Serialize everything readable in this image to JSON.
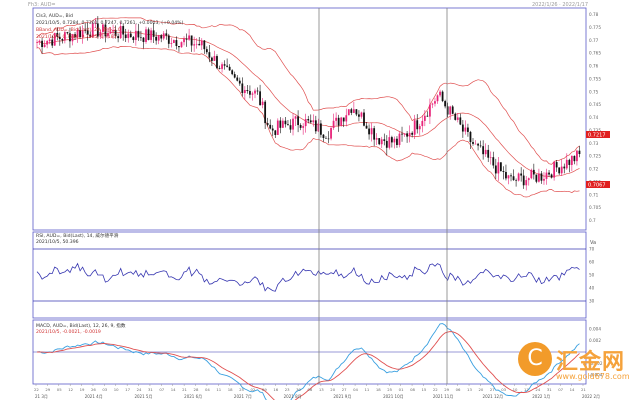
{
  "header": {
    "left": "Fh3: AUD=",
    "right": "2022/1/26 · 2022/1/17"
  },
  "main_panel": {
    "title": "Cls3, AUD=, Bid",
    "ohlc_line": "2021/10/5, 0.7284, 0.7301, 0.7247, 0.7261, +0.0003, (+0.04%)",
    "bb_title": "BBand, AUD=, Bid(Last), 20, 最多,2.0",
    "bb_values": "2021/10/5, 0.7386, 0.7285, 0.7183",
    "price_tag": "0.7217",
    "lower_tag": "0.7067",
    "y_ticks": [
      "0.78",
      "0.775",
      "0.77",
      "0.765",
      "0.76",
      "0.755",
      "0.75",
      "0.745",
      "0.74",
      "0.735",
      "0.73",
      "0.725",
      "0.72",
      "0.715",
      "0.71",
      "0.705",
      "0.7"
    ]
  },
  "rsi_panel": {
    "title": "RSI, AUD=, Bid(Last), 14, 威尔德平滑",
    "value_line": "2021/10/5, 50.396",
    "unit": "Va",
    "y_ticks": [
      "70",
      "60",
      "50",
      "40",
      "30"
    ]
  },
  "macd_panel": {
    "title": "MACD, AUD=, Bid(Last), 12, 26, 9, 指数",
    "value_line": "2021/10/5, -0.0021, -0.0019",
    "y_ticks": [
      "0.004",
      "0.002",
      "0",
      "-0.002",
      "-0.004"
    ]
  },
  "x_axis": {
    "ticks_top": [
      "22",
      "29",
      "05",
      "12",
      "19",
      "26",
      "03",
      "10",
      "17",
      "24",
      "31",
      "07",
      "14",
      "21",
      "28",
      "04",
      "11",
      "18",
      "25",
      "02",
      "09",
      "16",
      "23",
      "30",
      "06",
      "13",
      "20",
      "27",
      "04",
      "11",
      "18",
      "25",
      "01",
      "08",
      "15",
      "22",
      "29",
      "06",
      "13",
      "20",
      "27",
      "03",
      "10",
      "17",
      "24",
      "31",
      "07",
      "14",
      "21"
    ],
    "ticks_bottom": [
      "21 3月",
      "2021 4月",
      "2021 5月",
      "2021 6月",
      "2021 7月",
      "2021 8月",
      "2021 9月",
      "2021 10月",
      "2021 11月",
      "2021 12月",
      "2022 1月",
      "2022 2月"
    ]
  },
  "watermark": {
    "icon_char": "C",
    "brand": "汇金网",
    "url": "www.gold678.com"
  },
  "colors": {
    "panel_border": "#5a5ac8",
    "bollinger": "#e05050",
    "candle_dark": "#111111",
    "candle_up": "#e8247a",
    "rsi": "#3636b0",
    "macd_fast": "#3aa0e0",
    "macd_slow": "#e05050",
    "guide": "#808080",
    "tag": "#e02020"
  },
  "chart_data": {
    "type": "line",
    "title": "Cls3, AUD=, Bid",
    "xlabel": "",
    "ylabel": "",
    "x": [
      "2021-04",
      "2021-05",
      "2021-06",
      "2021-07",
      "2021-08",
      "2021-09",
      "2021-10",
      "2021-11",
      "2021-12",
      "2022-01",
      "2022-02"
    ],
    "ylim": [
      0.7,
      0.785
    ],
    "series": [
      {
        "name": "AUD=",
        "values": [
          0.772,
          0.778,
          0.773,
          0.75,
          0.737,
          0.733,
          0.749,
          0.722,
          0.711,
          0.718,
          0.722
        ]
      },
      {
        "name": "BBand",
        "values": [
          0.779,
          0.781,
          0.777,
          0.76,
          0.745,
          0.748,
          0.751,
          0.733,
          0.723,
          0.727,
          0.735
        ]
      },
      {
        "name": "RSI",
        "values": [
          52,
          58,
          50,
          35,
          45,
          50,
          62,
          35,
          36,
          51,
          52
        ]
      },
      {
        "name": "MACD",
        "values": [
          0.001,
          0.002,
          0.0,
          -0.003,
          -0.001,
          0.0,
          0.003,
          -0.003,
          -0.001,
          0.0,
          0.002
        ]
      }
    ]
  }
}
